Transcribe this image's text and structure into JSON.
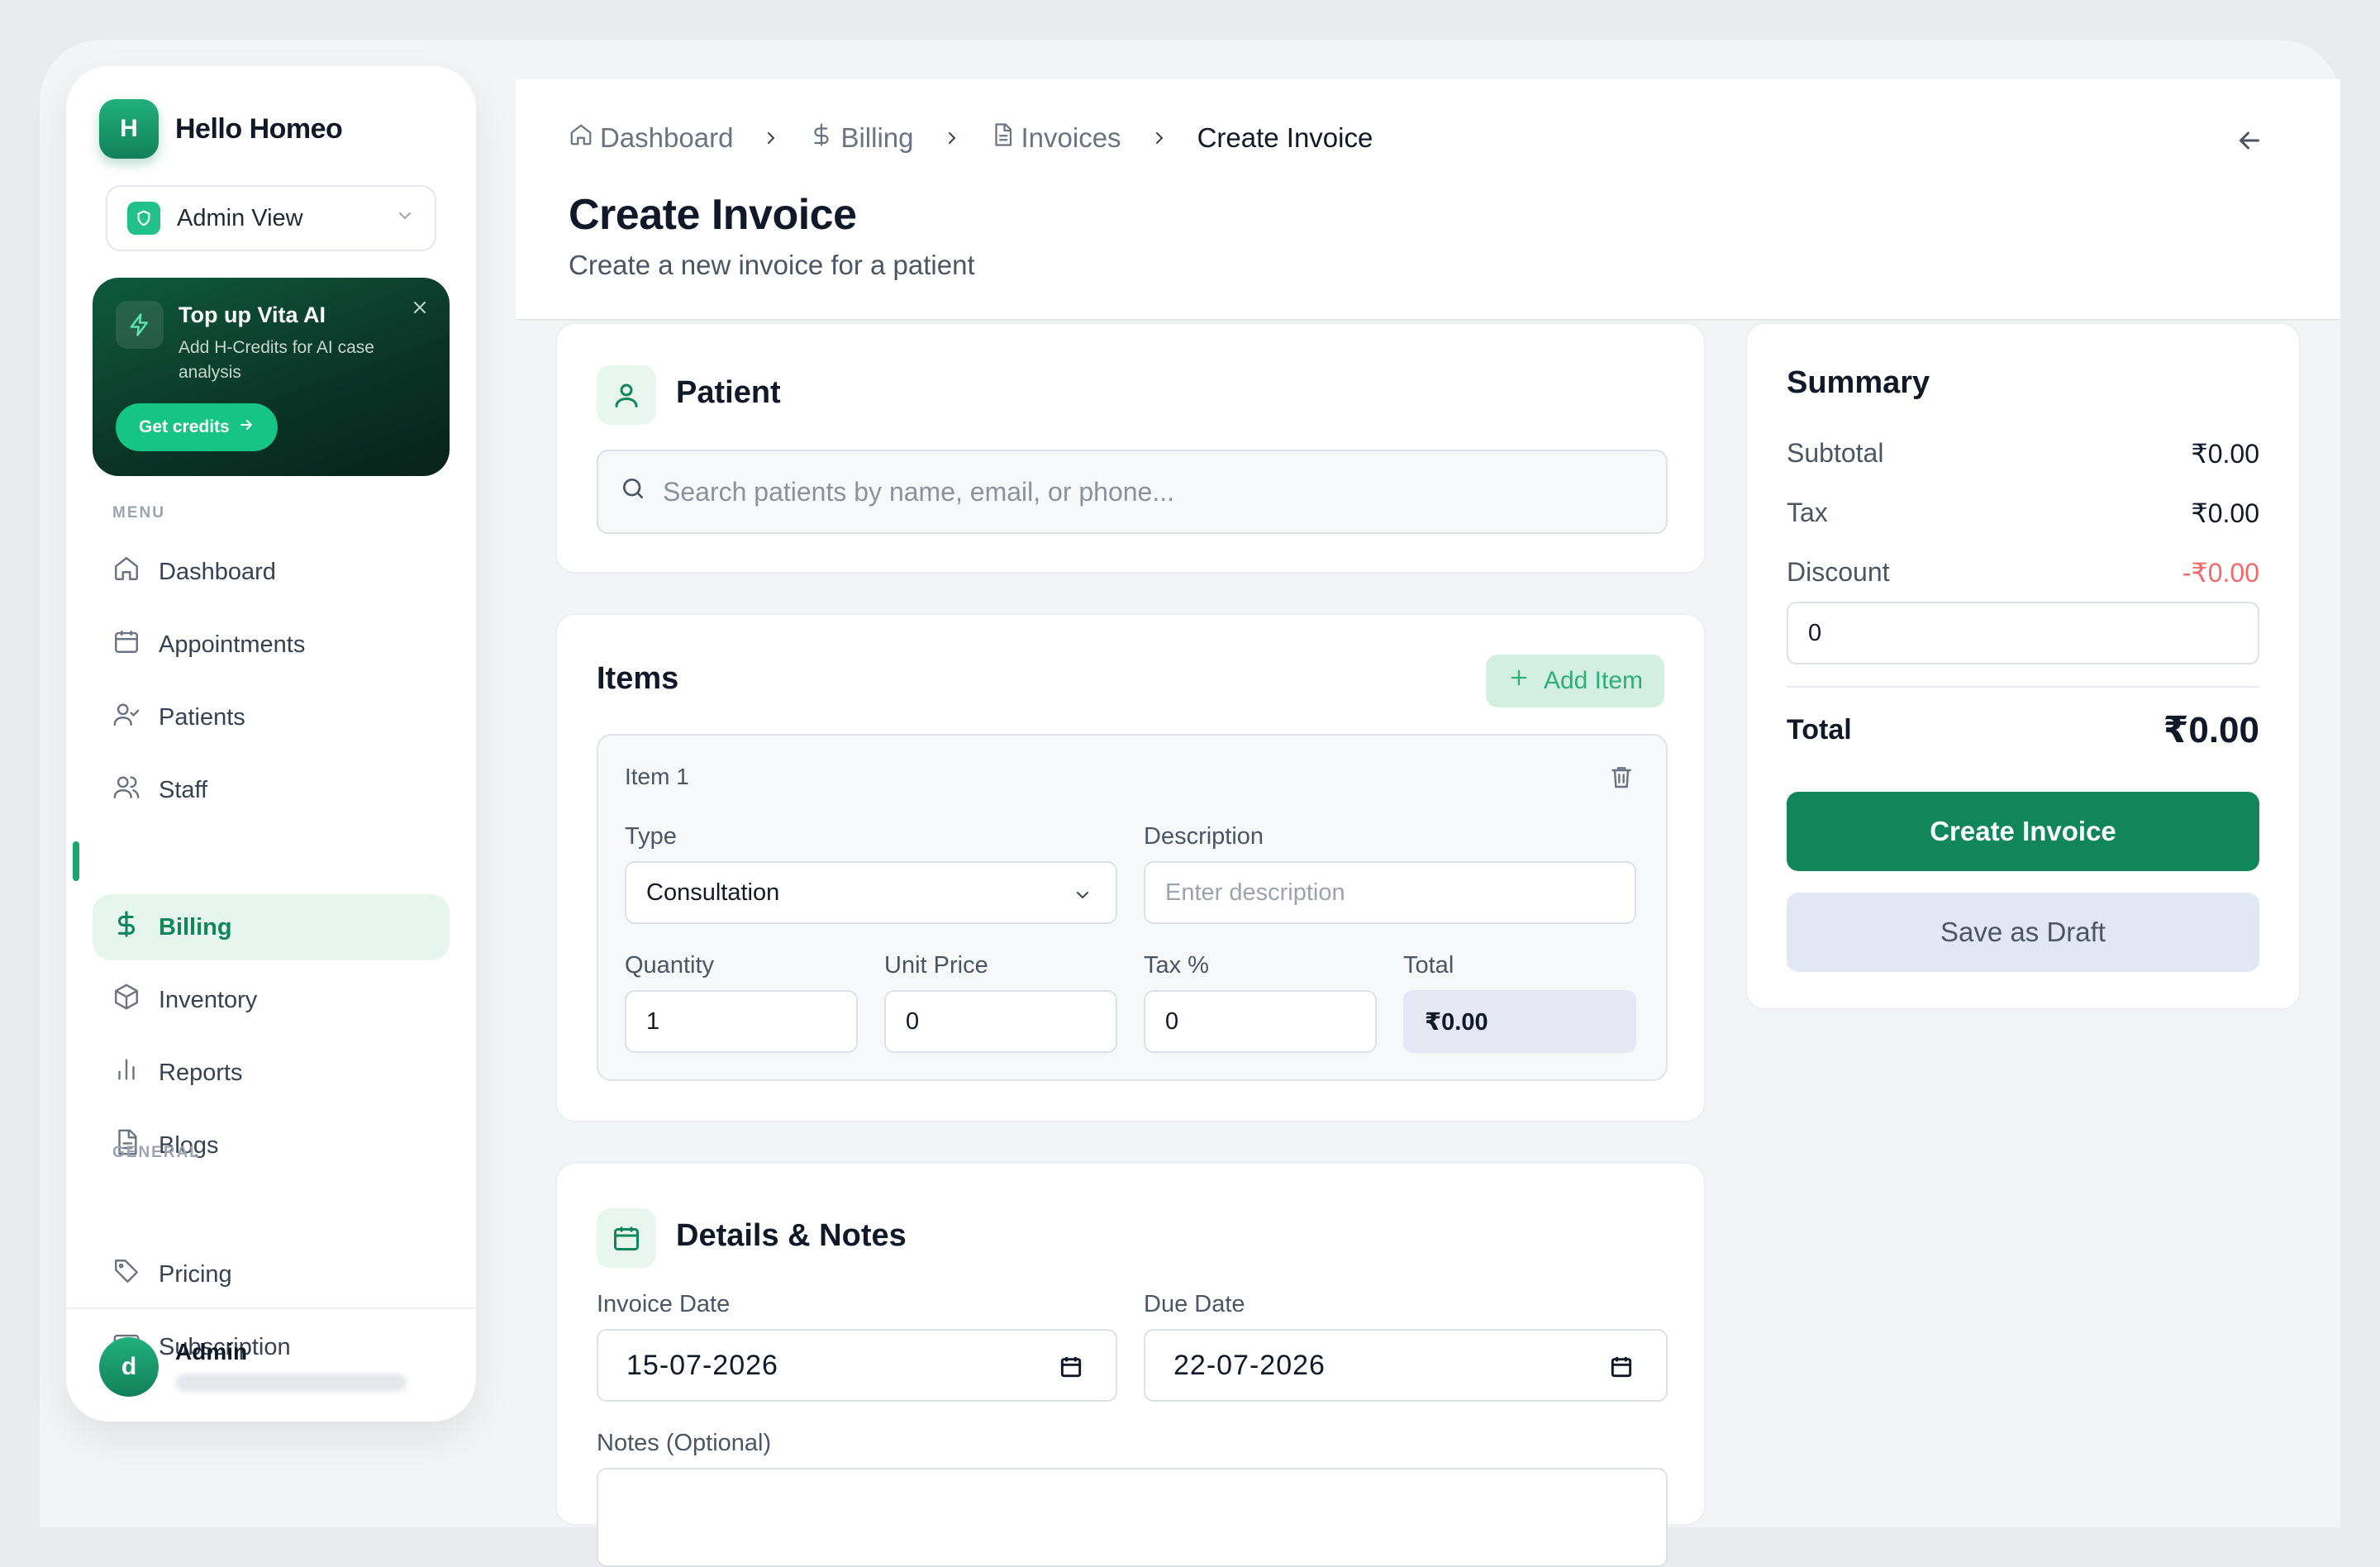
{
  "brand": {
    "logo_letter": "H",
    "name": "Hello Homeo"
  },
  "view_select": {
    "value": "Admin View"
  },
  "promo": {
    "title": "Top up Vita AI",
    "subtitle": "Add H-Credits for AI case analysis",
    "button": "Get credits"
  },
  "sidebar": {
    "menu_label": "MENU",
    "general_label": "GENERAL",
    "items": [
      {
        "label": "Dashboard",
        "icon": "home-icon"
      },
      {
        "label": "Appointments",
        "icon": "calendar-icon"
      },
      {
        "label": "Patients",
        "icon": "user-check-icon"
      },
      {
        "label": "Staff",
        "icon": "users-icon"
      },
      {
        "label": "Billing",
        "icon": "dollar-icon",
        "active": true
      },
      {
        "label": "Inventory",
        "icon": "box-icon"
      },
      {
        "label": "Reports",
        "icon": "bar-chart-icon"
      },
      {
        "label": "Blogs",
        "icon": "file-icon"
      }
    ],
    "general_items": [
      {
        "label": "Pricing",
        "icon": "tag-icon"
      },
      {
        "label": "Subscription",
        "icon": "credit-card-icon"
      }
    ]
  },
  "user": {
    "avatar_letter": "d",
    "name": "Admin"
  },
  "breadcrumb": [
    "Dashboard",
    "Billing",
    "Invoices",
    "Create Invoice"
  ],
  "header": {
    "title": "Create Invoice",
    "subtitle": "Create a new invoice for a patient"
  },
  "patient": {
    "title": "Patient",
    "search_placeholder": "Search patients by name, email, or phone..."
  },
  "items": {
    "title": "Items",
    "add_label": "Add Item",
    "item": {
      "name": "Item 1",
      "type_label": "Type",
      "type_value": "Consultation",
      "description_label": "Description",
      "description_placeholder": "Enter description",
      "quantity_label": "Quantity",
      "quantity_value": "1",
      "unit_price_label": "Unit Price",
      "unit_price_value": "0",
      "tax_label": "Tax %",
      "tax_value": "0",
      "total_label": "Total",
      "total_value": "₹0.00"
    }
  },
  "details": {
    "title": "Details & Notes",
    "invoice_date_label": "Invoice Date",
    "invoice_date": "15-07-2026",
    "due_date_label": "Due Date",
    "due_date": "22-07-2026",
    "notes_label": "Notes (Optional)"
  },
  "summary": {
    "title": "Summary",
    "subtotal_label": "Subtotal",
    "subtotal": "₹0.00",
    "tax_label": "Tax",
    "tax": "₹0.00",
    "discount_label": "Discount",
    "discount": "-₹0.00",
    "discount_input": "0",
    "total_label": "Total",
    "total": "₹0.00",
    "create_button": "Create Invoice",
    "draft_button": "Save as Draft"
  },
  "colors": {
    "brand": "#11865a",
    "accent": "#1aa56f",
    "negative": "#ef6a6a"
  }
}
